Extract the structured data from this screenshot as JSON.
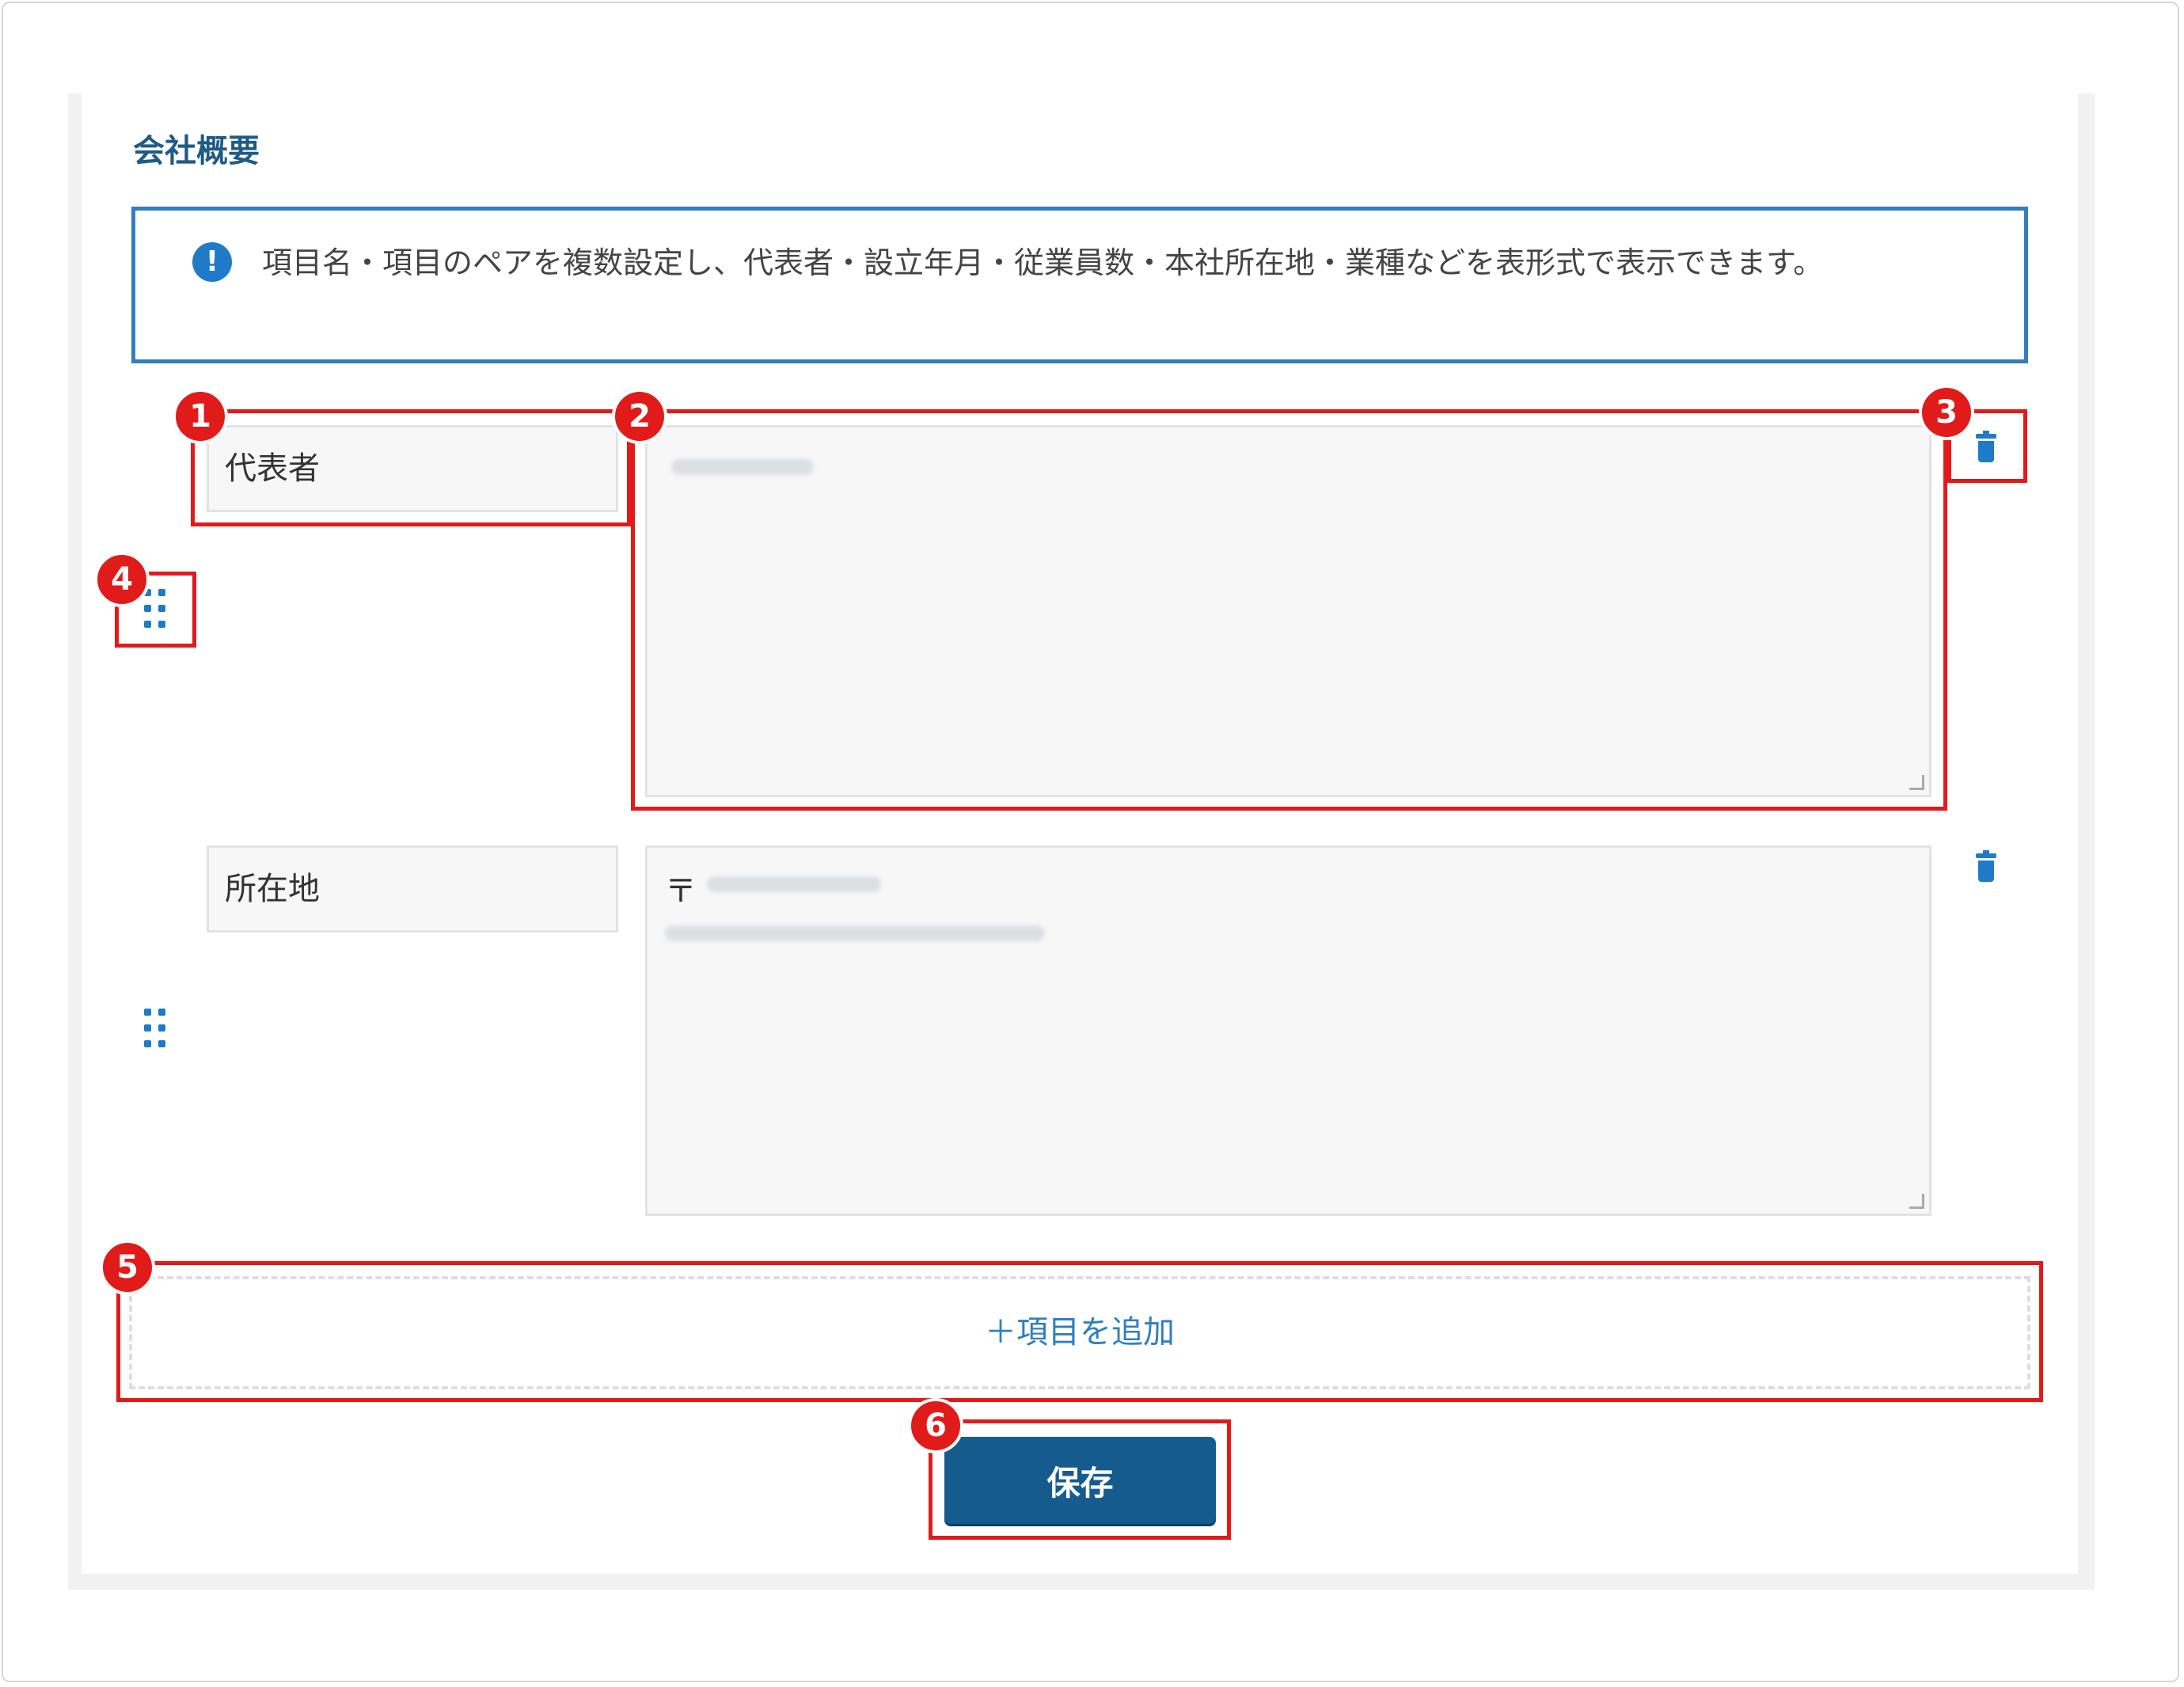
{
  "section": {
    "title": "会社概要"
  },
  "notice": {
    "icon": "exclamation-circle-icon",
    "icon_glyph": "!",
    "text": "項目名・項目のペアを複数設定し、代表者・設立年月・従業員数・本社所在地・業種などを表形式で表示できます。"
  },
  "rows": [
    {
      "label": "代表者",
      "value_blurred": true
    },
    {
      "label": "所在地",
      "postal_mark": "〒",
      "value_blurred": true
    }
  ],
  "add_item": {
    "label": "＋項目を追加"
  },
  "save": {
    "label": "保存"
  },
  "annotations": {
    "badges": [
      "1",
      "2",
      "3",
      "4",
      "5",
      "6"
    ],
    "color": "#e11a1a"
  },
  "colors": {
    "accent": "#2f7fc1",
    "primary_button": "#155b8d",
    "title": "#1e5b86"
  }
}
